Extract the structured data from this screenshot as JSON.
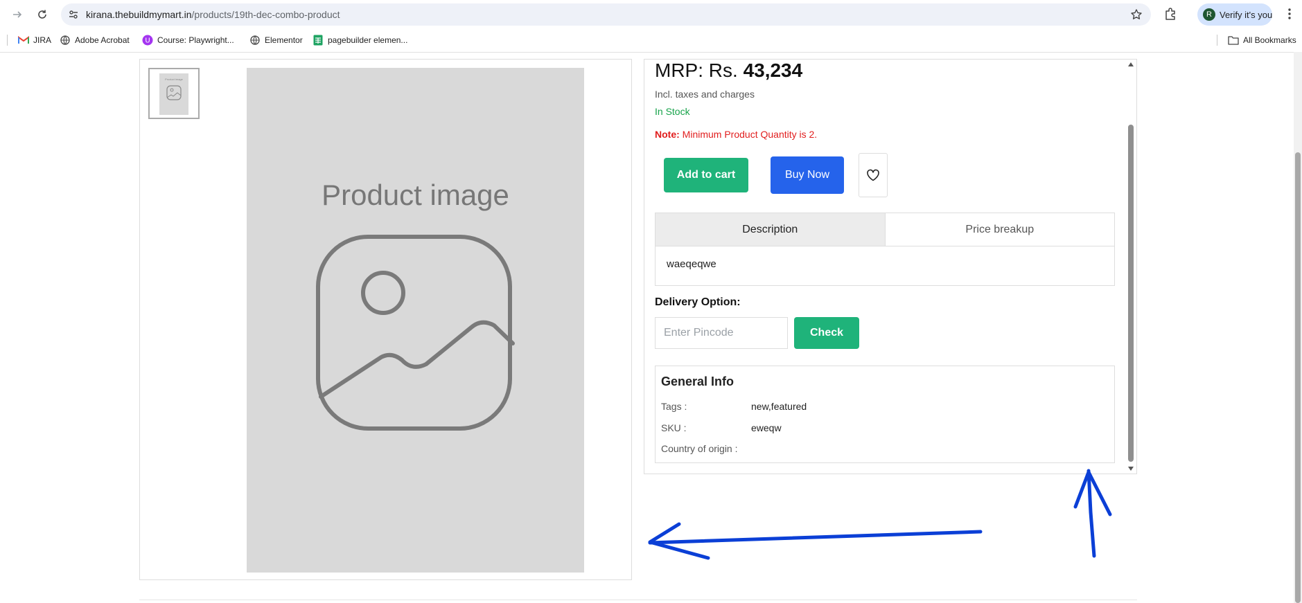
{
  "browser": {
    "url_host": "kirana.thebuildmymart.in",
    "url_path": "/products/19th-dec-combo-product",
    "profile_label": "Verify it's you",
    "profile_initial": "R",
    "bookmarks": [
      {
        "label": "JIRA",
        "icon": "gmail-icon"
      },
      {
        "label": "Adobe Acrobat",
        "icon": "globe-icon"
      },
      {
        "label": "Course: Playwright...",
        "icon": "course-icon"
      },
      {
        "label": "Elementor",
        "icon": "globe-icon"
      },
      {
        "label": "pagebuilder elemen...",
        "icon": "sheets-icon"
      }
    ],
    "all_bookmarks_label": "All Bookmarks"
  },
  "gallery": {
    "thumbnail_text": "Product image",
    "main_image_text": "Product image"
  },
  "product": {
    "mrp_prefix": "MRP: Rs.",
    "mrp_value": "43,234",
    "tax_note": "Incl. taxes and charges",
    "stock_status": "In Stock",
    "note_label": "Note:",
    "note_text": "Minimum Product Quantity is 2.",
    "add_to_cart_label": "Add to cart",
    "buy_now_label": "Buy Now"
  },
  "tabs": {
    "items": [
      "Description",
      "Price breakup"
    ],
    "active": "Description",
    "content": "waeqeqwe"
  },
  "delivery": {
    "title": "Delivery Option:",
    "pincode_placeholder": "Enter Pincode",
    "check_label": "Check"
  },
  "general_info": {
    "title": "General Info",
    "rows": [
      {
        "key": "Tags :",
        "value": "new,featured"
      },
      {
        "key": "SKU :",
        "value": "eweqw"
      },
      {
        "key": "Country of origin :",
        "value": ""
      }
    ]
  },
  "colors": {
    "accent_green": "#1fb37a",
    "accent_blue": "#2563eb",
    "stock_green": "#16a34a",
    "note_red": "#e11d1d",
    "annotation_blue": "#0b3fd6"
  }
}
